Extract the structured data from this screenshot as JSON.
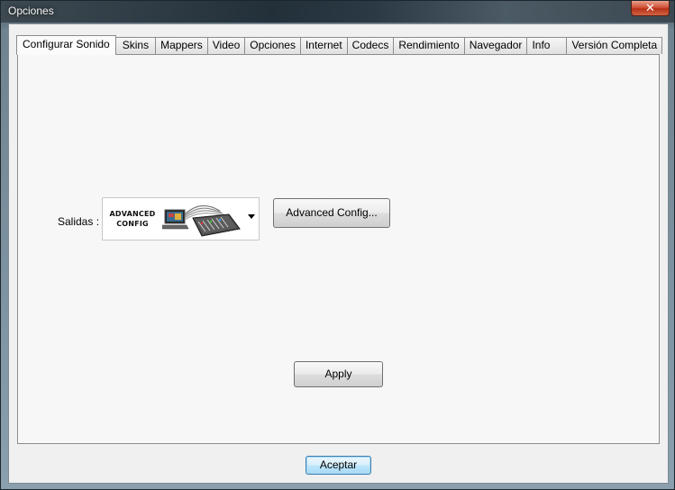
{
  "window": {
    "title": "Opciones",
    "close_label": "✕"
  },
  "tabs": [
    {
      "label": "Configurar Sonido",
      "active": true
    },
    {
      "label": "Skins"
    },
    {
      "label": "Mappers"
    },
    {
      "label": "Video"
    },
    {
      "label": "Opciones"
    },
    {
      "label": "Internet"
    },
    {
      "label": "Codecs"
    },
    {
      "label": "Rendimiento"
    },
    {
      "label": "Navegador"
    },
    {
      "label": "Info"
    },
    {
      "label": "Versión Completa"
    }
  ],
  "sound": {
    "outputs_label": "Salidas :",
    "outputs_value_line1": "ADVANCED",
    "outputs_value_line2": "CONFIG",
    "advanced_button": "Advanced Config...",
    "apply_button": "Apply"
  },
  "footer": {
    "accept_button": "Aceptar"
  },
  "colors": {
    "accent": "#3c7fb1",
    "close": "#c7442a"
  },
  "icons": {
    "combo_image": "laptop-mixer-icon",
    "dropdown": "dropdown-arrow-icon"
  }
}
